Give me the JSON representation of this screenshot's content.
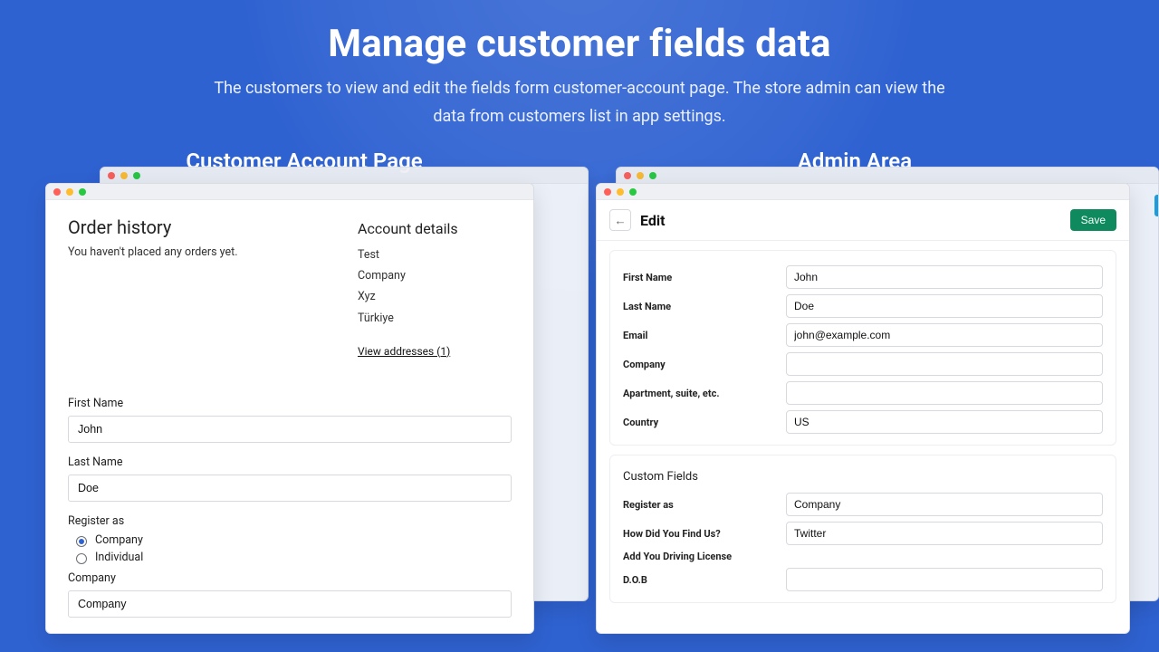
{
  "hero": {
    "title": "Manage customer fields data",
    "subtitle": "The customers to view and edit the fields form customer-account page. The store admin can view the data from customers list in app settings."
  },
  "columns": {
    "left_title": "Customer Account Page",
    "right_title": "Admin Area"
  },
  "customer_page": {
    "order_history_title": "Order history",
    "order_history_empty": "You haven't placed any orders yet.",
    "account_details_title": "Account details",
    "account_details": [
      "Test",
      "Company",
      "Xyz",
      "Türkiye"
    ],
    "view_addresses": "View addresses (1)",
    "first_name_label": "First Name",
    "first_name_value": "John",
    "last_name_label": "Last Name",
    "last_name_value": "Doe",
    "register_as_label": "Register as",
    "register_options": [
      "Company",
      "Individual"
    ],
    "register_selected": "Company",
    "company_label": "Company",
    "company_value": "Company"
  },
  "admin": {
    "edit_title": "Edit",
    "save_label": "Save",
    "fields": [
      {
        "label": "First Name",
        "value": "John"
      },
      {
        "label": "Last Name",
        "value": "Doe"
      },
      {
        "label": "Email",
        "value": "john@example.com"
      },
      {
        "label": "Company",
        "value": ""
      },
      {
        "label": "Apartment, suite, etc.",
        "value": ""
      },
      {
        "label": "Country",
        "value": "US"
      }
    ],
    "custom_title": "Custom Fields",
    "custom_fields": [
      {
        "label": "Register as",
        "value": "Company",
        "type": "text"
      },
      {
        "label": "How Did You Find Us?",
        "value": "Twitter",
        "type": "text"
      },
      {
        "label": "Add You Driving License",
        "value": "",
        "type": "file"
      },
      {
        "label": "D.O.B",
        "value": "",
        "type": "text"
      }
    ]
  }
}
